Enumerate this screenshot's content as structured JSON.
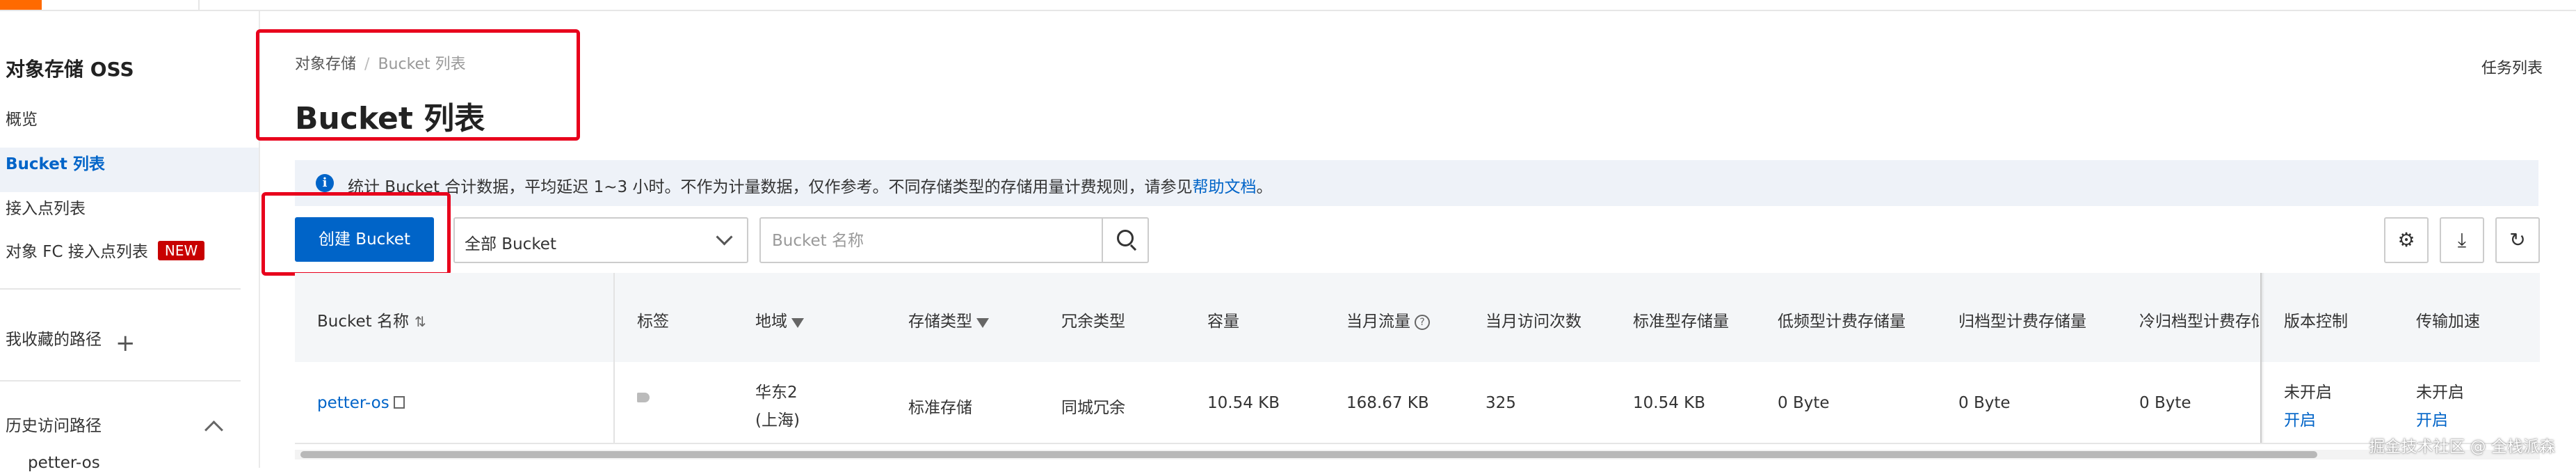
{
  "sidebar": {
    "title": "对象存储 OSS",
    "items": [
      {
        "label": "概览"
      },
      {
        "label": "Bucket 列表"
      },
      {
        "label": "接入点列表"
      },
      {
        "label": "对象 FC 接入点列表",
        "badge": "NEW"
      }
    ],
    "favorites_label": "我收藏的路径",
    "history_label": "历史访问路径",
    "history_item": "petter-os"
  },
  "header": {
    "breadcrumb": [
      "对象存储",
      "Bucket 列表"
    ],
    "title": "Bucket 列表",
    "task_list": "任务列表"
  },
  "notice": {
    "text": "统计 Bucket 合计数据，平均延迟 1~3 小时。不作为计量数据，仅作参考。不同存储类型的存储用量计费规则，请参见",
    "link": "帮助文档",
    "suffix": "。"
  },
  "toolbar": {
    "create_label": "创建 Bucket",
    "filter_value": "全部 Bucket",
    "search_placeholder": "Bucket 名称"
  },
  "table": {
    "columns": [
      "Bucket 名称",
      "标签",
      "地域",
      "存储类型",
      "冗余类型",
      "容量",
      "当月流量",
      "当月访问次数",
      "标准型存储量",
      "低频型计费存储量",
      "归档型计费存储量",
      "冷归档型计费存储",
      "版本控制",
      "传输加速"
    ],
    "rows": [
      {
        "name": "petter-os",
        "region_line1": "华东2",
        "region_line2": "(上海)",
        "storage_class": "标准存储",
        "redundancy": "同城冗余",
        "capacity": "10.54 KB",
        "traffic": "168.67 KB",
        "requests": "325",
        "standard": "10.54 KB",
        "ia": "0 Byte",
        "archive": "0 Byte",
        "cold_archive": "0 Byte",
        "versioning": "未开启",
        "versioning_action": "开启",
        "acceleration": "未开启",
        "acceleration_action": "开启"
      }
    ]
  },
  "watermark": "掘金技术社区 @ 全栈派森",
  "colors": {
    "accent": "#0064c8",
    "badge": "#c80000",
    "highlight": "#e8001c"
  }
}
